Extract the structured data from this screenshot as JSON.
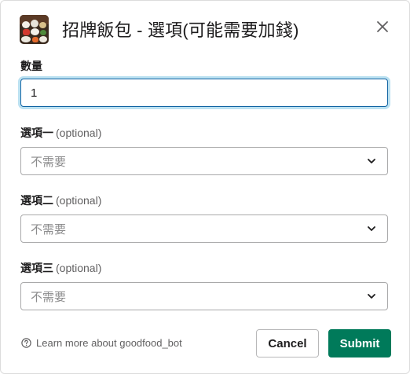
{
  "modal": {
    "title": "招牌飯包 - 選項(可能需要加錢)",
    "app_icon": "bento-food-icon",
    "close_icon": "close-icon"
  },
  "fields": {
    "quantity": {
      "label": "數量",
      "value": "1"
    },
    "option1": {
      "label": "選項一",
      "optional": "(optional)",
      "selected": "不需要"
    },
    "option2": {
      "label": "選項二",
      "optional": "(optional)",
      "selected": "不需要"
    },
    "option3": {
      "label": "選項三",
      "optional": "(optional)",
      "selected": "不需要"
    }
  },
  "footer": {
    "learn_more": "Learn more about goodfood_bot",
    "cancel_label": "Cancel",
    "submit_label": "Submit"
  },
  "colors": {
    "submit_bg": "#007a5a",
    "focus_border": "#1264a3",
    "text": "#1d1c1d",
    "muted": "#616061"
  }
}
